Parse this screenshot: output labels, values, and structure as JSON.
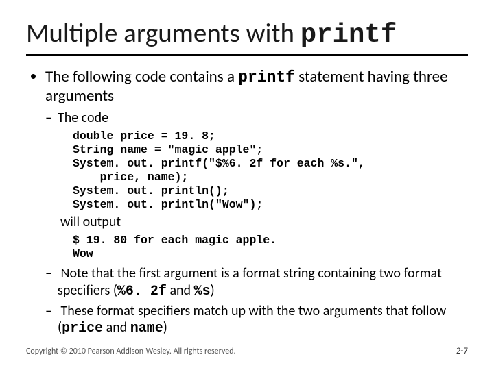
{
  "title": {
    "pre": "Multiple arguments with ",
    "code": "printf"
  },
  "bullet1": {
    "pre": "The following code contains a ",
    "code": "printf",
    "post": " statement having three arguments"
  },
  "sub_codelabel": "The code",
  "code": {
    "l1": "double price = 19. 8;",
    "l2": "String name = \"magic apple\";",
    "l3": "System. out. printf(\"$%6. 2f for each %s.\",",
    "l4": "    price, name);",
    "l5": "System. out. println();",
    "l6": "System. out. println(\"Wow\");"
  },
  "will_output": "will output",
  "out": {
    "l1": "$ 19. 80 for each magic apple.",
    "l2": "Wow"
  },
  "note1": {
    "pre": "Note that the first argument is a format string containing two format specifiers (",
    "c1": "%6. 2f",
    "mid": " and ",
    "c2": "%s",
    "post": ")"
  },
  "note2": {
    "pre": "These format specifiers match up with the two arguments that follow (",
    "c1": "price",
    "mid": " and ",
    "c2": "name",
    "post": ")"
  },
  "footer": {
    "copyright": "Copyright © 2010 Pearson Addison-Wesley. All rights reserved.",
    "pagenum": "2-7"
  }
}
